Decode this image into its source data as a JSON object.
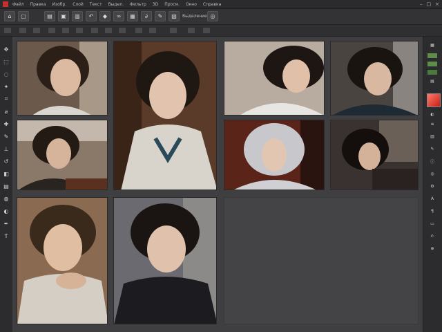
{
  "menu": [
    "Файл",
    "Правка",
    "Изобр.",
    "Слой",
    "Текст",
    "Выдел.",
    "Фильтр",
    "3D",
    "Просм.",
    "Окно",
    "Справка"
  ],
  "toolbar": {
    "buttons": [
      "home-icon",
      "new-file-icon",
      "open-icon",
      "save-icon",
      "print-icon",
      "undo-icon",
      "redo-icon",
      "brush-icon",
      "eraser-icon",
      "crop-icon",
      "layers-icon",
      "zoom-icon",
      "settings-icon"
    ],
    "label": "Выделение"
  },
  "left_tools": [
    "move",
    "marquee",
    "lasso",
    "wand",
    "crop",
    "eyedropper",
    "heal",
    "brush",
    "stamp",
    "history",
    "eraser",
    "gradient",
    "blur",
    "dodge",
    "pen",
    "type",
    "path",
    "shape",
    "hand",
    "zoom"
  ],
  "right_panel": [
    "layers",
    "channels",
    "paths",
    "history",
    "actions",
    "adjust",
    "styles",
    "swatches",
    "color",
    "brushes",
    "info",
    "navigator"
  ],
  "tiles": [
    {
      "id": "portrait-1"
    },
    {
      "id": "portrait-2"
    },
    {
      "id": "portrait-3"
    },
    {
      "id": "portrait-4"
    },
    {
      "id": "portrait-5"
    },
    {
      "id": "portrait-6"
    },
    {
      "id": "portrait-7"
    },
    {
      "id": "portrait-8"
    },
    {
      "id": "portrait-9"
    },
    {
      "id": "portrait-10"
    }
  ],
  "colors": {
    "bg": "#3f3f41",
    "accent": "#c8302b"
  }
}
